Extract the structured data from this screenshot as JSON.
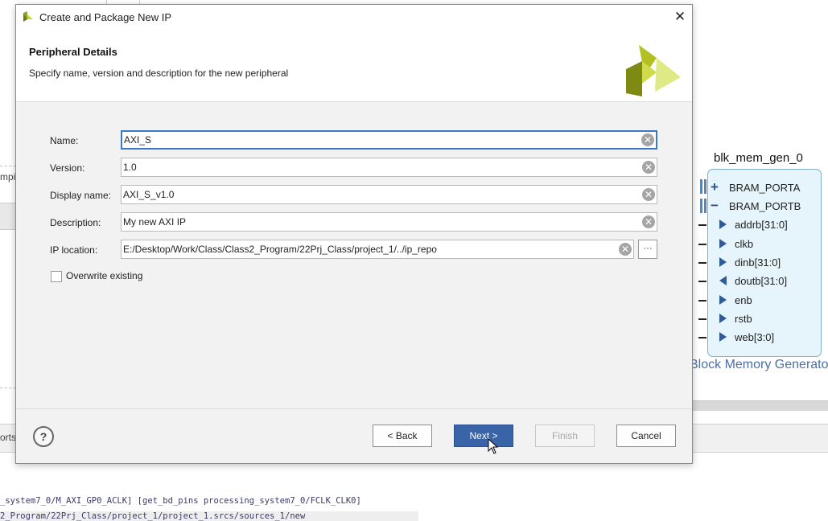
{
  "background": {
    "left_fragment_1": "mpi",
    "left_fragment_2": "orts",
    "tcl_line_1": "_system7_0/M_AXI_GP0_ACLK] [get_bd_pins processing_system7_0/FCLK_CLK0]",
    "tcl_line_2": "2_Program/22Prj_Class/project_1/project_1.srcs/sources_1/new",
    "block": {
      "title": "blk_mem_gen_0",
      "subtitle": "Block Memory Generato",
      "ports": [
        "BRAM_PORTA",
        "BRAM_PORTB",
        "addrb[31:0]",
        "clkb",
        "dinb[31:0]",
        "doutb[31:0]",
        "enb",
        "rstb",
        "web[3:0]"
      ]
    }
  },
  "dialog": {
    "title": "Create and Package New IP",
    "close_glyph": "✕",
    "header_title": "Peripheral Details",
    "header_subtitle": "Specify name, version and description for the new peripheral",
    "fields": {
      "name_label": "Name:",
      "name_value": "AXI_S",
      "version_label": "Version:",
      "version_value": "1.0",
      "display_name_label": "Display name:",
      "display_name_value": "AXI_S_v1.0",
      "description_label": "Description:",
      "description_value": "My new AXI IP",
      "ip_location_label": "IP location:",
      "ip_location_value": "E:/Desktop/Work/Class/Class2_Program/22Prj_Class/project_1/../ip_repo",
      "browse_label": "···"
    },
    "overwrite_label": "Overwrite existing",
    "help_label": "?",
    "buttons": {
      "back": "< Back",
      "next": "Next >",
      "finish": "Finish",
      "cancel": "Cancel"
    },
    "colors": {
      "primary_button": "#3a64a8",
      "focus_border": "#3d78c8"
    }
  }
}
